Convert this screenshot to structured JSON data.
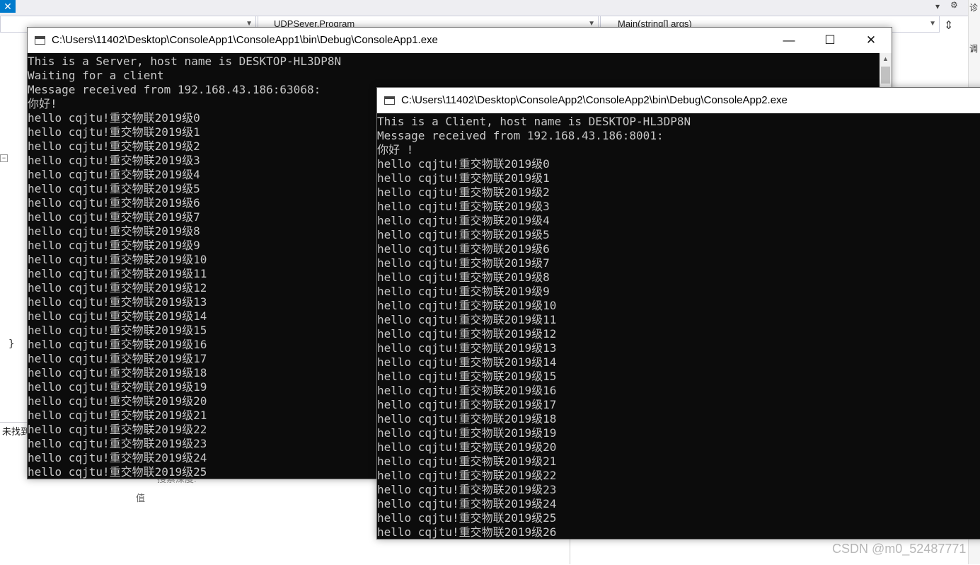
{
  "ide": {
    "project_dropdown": "",
    "class_dropdown": "UDPSever.Program",
    "member_dropdown": "Main(string[] args)",
    "close_glyph": "✕",
    "not_found_label": "未找到",
    "search_depth_label": "搜索深度:",
    "value_column_header": "值",
    "brace": "}",
    "right_strip_chars": [
      "诊",
      "调"
    ],
    "watermark": "CSDN @m0_52487771"
  },
  "server_window": {
    "title": "C:\\Users\\11402\\Desktop\\ConsoleApp1\\ConsoleApp1\\bin\\Debug\\ConsoleApp1.exe",
    "minimize_glyph": "—",
    "maximize_glyph": "☐",
    "close_glyph": "✕",
    "lines": [
      "This is a Server, host name is DESKTOP-HL3DP8N",
      "Waiting for a client",
      "Message received from 192.168.43.186:63068:",
      "你好!",
      "hello cqjtu!重交物联2019级0",
      "hello cqjtu!重交物联2019级1",
      "hello cqjtu!重交物联2019级2",
      "hello cqjtu!重交物联2019级3",
      "hello cqjtu!重交物联2019级4",
      "hello cqjtu!重交物联2019级5",
      "hello cqjtu!重交物联2019级6",
      "hello cqjtu!重交物联2019级7",
      "hello cqjtu!重交物联2019级8",
      "hello cqjtu!重交物联2019级9",
      "hello cqjtu!重交物联2019级10",
      "hello cqjtu!重交物联2019级11",
      "hello cqjtu!重交物联2019级12",
      "hello cqjtu!重交物联2019级13",
      "hello cqjtu!重交物联2019级14",
      "hello cqjtu!重交物联2019级15",
      "hello cqjtu!重交物联2019级16",
      "hello cqjtu!重交物联2019级17",
      "hello cqjtu!重交物联2019级18",
      "hello cqjtu!重交物联2019级19",
      "hello cqjtu!重交物联2019级20",
      "hello cqjtu!重交物联2019级21",
      "hello cqjtu!重交物联2019级22",
      "hello cqjtu!重交物联2019级23",
      "hello cqjtu!重交物联2019级24",
      "hello cqjtu!重交物联2019级25"
    ]
  },
  "client_window": {
    "title": "C:\\Users\\11402\\Desktop\\ConsoleApp2\\ConsoleApp2\\bin\\Debug\\ConsoleApp2.exe",
    "lines": [
      "This is a Client, host name is DESKTOP-HL3DP8N",
      "Message received from 192.168.43.186:8001:",
      "你好 !",
      "hello cqjtu!重交物联2019级0",
      "hello cqjtu!重交物联2019级1",
      "hello cqjtu!重交物联2019级2",
      "hello cqjtu!重交物联2019级3",
      "hello cqjtu!重交物联2019级4",
      "hello cqjtu!重交物联2019级5",
      "hello cqjtu!重交物联2019级6",
      "hello cqjtu!重交物联2019级7",
      "hello cqjtu!重交物联2019级8",
      "hello cqjtu!重交物联2019级9",
      "hello cqjtu!重交物联2019级10",
      "hello cqjtu!重交物联2019级11",
      "hello cqjtu!重交物联2019级12",
      "hello cqjtu!重交物联2019级13",
      "hello cqjtu!重交物联2019级14",
      "hello cqjtu!重交物联2019级15",
      "hello cqjtu!重交物联2019级16",
      "hello cqjtu!重交物联2019级17",
      "hello cqjtu!重交物联2019级18",
      "hello cqjtu!重交物联2019级19",
      "hello cqjtu!重交物联2019级20",
      "hello cqjtu!重交物联2019级21",
      "hello cqjtu!重交物联2019级22",
      "hello cqjtu!重交物联2019级23",
      "hello cqjtu!重交物联2019级24",
      "hello cqjtu!重交物联2019级25",
      "hello cqjtu!重交物联2019级26"
    ]
  }
}
